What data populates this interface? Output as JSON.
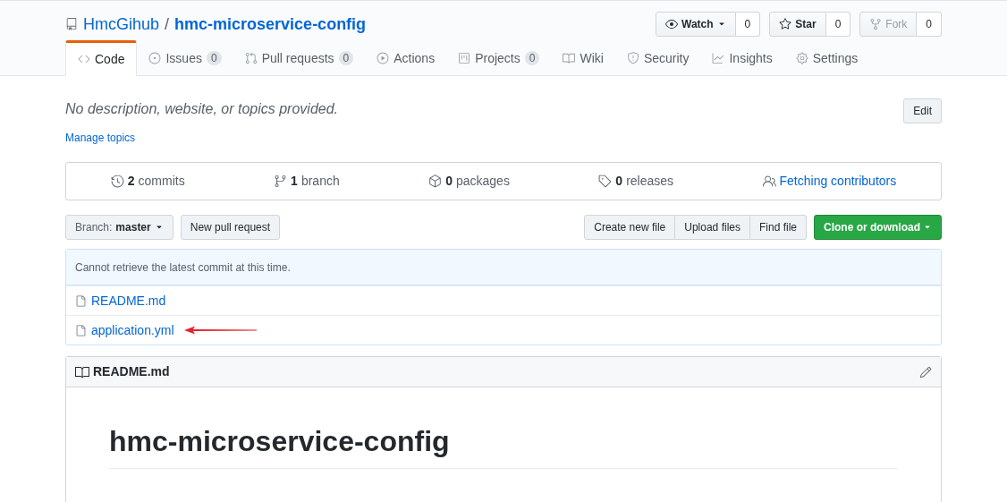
{
  "repo": {
    "owner": "HmcGihub",
    "separator": "/",
    "name": "hmc-microservice-config"
  },
  "social_buttons": [
    {
      "kind": "watch",
      "label": "Watch",
      "count": "0",
      "disabled": false,
      "dropdown": true
    },
    {
      "kind": "star",
      "label": "Star",
      "count": "0",
      "disabled": false,
      "dropdown": false
    },
    {
      "kind": "fork",
      "label": "Fork",
      "count": "0",
      "disabled": true,
      "dropdown": false
    }
  ],
  "tabs": [
    {
      "kind": "code",
      "label": "Code",
      "selected": true
    },
    {
      "kind": "issues",
      "label": "Issues",
      "count": "0",
      "selected": false
    },
    {
      "kind": "pulls",
      "label": "Pull requests",
      "count": "0",
      "selected": false
    },
    {
      "kind": "actions",
      "label": "Actions",
      "selected": false
    },
    {
      "kind": "projects",
      "label": "Projects",
      "count": "0",
      "selected": false
    },
    {
      "kind": "wiki",
      "label": "Wiki",
      "selected": false
    },
    {
      "kind": "security",
      "label": "Security",
      "selected": false
    },
    {
      "kind": "insights",
      "label": "Insights",
      "selected": false
    },
    {
      "kind": "settings",
      "label": "Settings",
      "selected": false
    }
  ],
  "description": "No description, website, or topics provided.",
  "edit_button": "Edit",
  "manage_topics": "Manage topics",
  "stats": [
    {
      "kind": "commits",
      "count": "2",
      "label": "commits"
    },
    {
      "kind": "branch",
      "count": "1",
      "label": "branch"
    },
    {
      "kind": "packages",
      "count": "0",
      "label": "packages"
    },
    {
      "kind": "releases",
      "count": "0",
      "label": "releases"
    },
    {
      "kind": "contributors",
      "label": "Fetching contributors"
    }
  ],
  "branch_select": {
    "label": "Branch:",
    "value": "master"
  },
  "new_pull_request": "New pull request",
  "file_actions": [
    "Create new file",
    "Upload files",
    "Find file"
  ],
  "clone_button": "Clone or download",
  "commit_message": "Cannot retrieve the latest commit at this time.",
  "files": [
    {
      "name": "README.md",
      "annotated": false
    },
    {
      "name": "application.yml",
      "annotated": true
    }
  ],
  "readme": {
    "filename": "README.md",
    "heading": "hmc-microservice-config"
  }
}
